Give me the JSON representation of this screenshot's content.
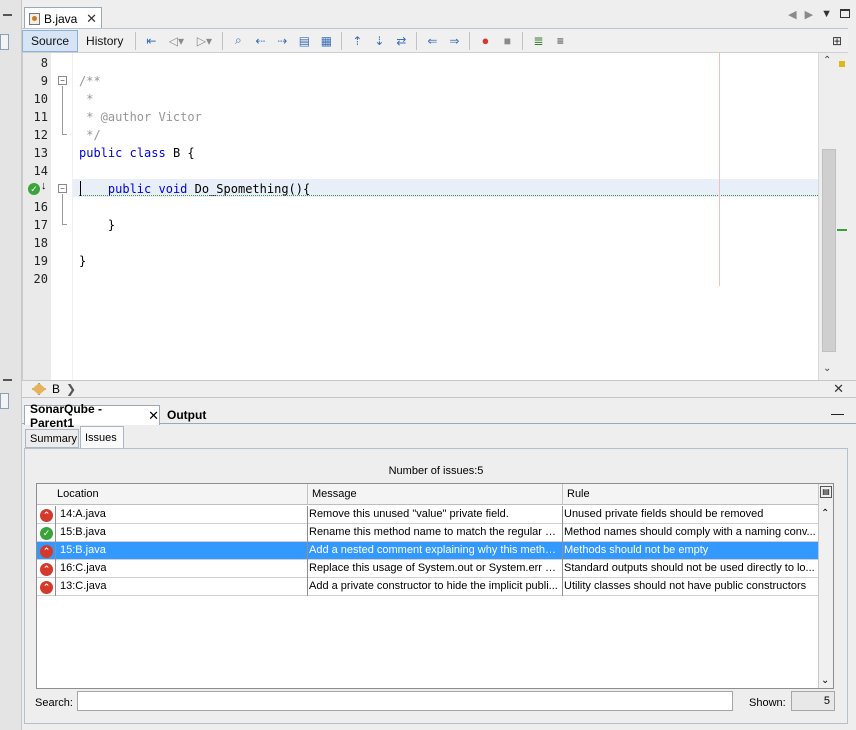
{
  "editor": {
    "file_tab": "B.java",
    "file_tab_close": "✕",
    "view_tabs": [
      "Source",
      "History"
    ],
    "active_view": "Source"
  },
  "code": {
    "line_numbers": [
      "8",
      "9",
      "10",
      "11",
      "12",
      "13",
      "14",
      "",
      "16",
      "17",
      "18",
      "19",
      "20"
    ],
    "lines": [
      {
        "n": "8",
        "text": ""
      },
      {
        "n": "9",
        "text": "/**",
        "cls": "cm"
      },
      {
        "n": "10",
        "text": " *",
        "cls": "cm"
      },
      {
        "n": "11",
        "text": " * @author Victor",
        "cls": "cm"
      },
      {
        "n": "12",
        "text": " */",
        "cls": "cm"
      },
      {
        "n": "13",
        "text": "public class B {"
      },
      {
        "n": "14",
        "text": ""
      },
      {
        "n": "15",
        "text": "    public void Do_Spomething(){"
      },
      {
        "n": "16",
        "text": ""
      },
      {
        "n": "17",
        "text": "    }"
      },
      {
        "n": "18",
        "text": ""
      },
      {
        "n": "19",
        "text": "}"
      },
      {
        "n": "20",
        "text": ""
      }
    ]
  },
  "breadcrumb": {
    "item": "B",
    "close": "✕"
  },
  "bottom": {
    "tabs": [
      {
        "label": "SonarQube - Parent1",
        "close": "✕"
      },
      {
        "label": "Output"
      }
    ],
    "subtabs": [
      "Summary",
      "Issues"
    ],
    "active_subtab": "Issues",
    "issue_count_label": "Number of issues:5",
    "columns": [
      "Location",
      "Message",
      "Rule"
    ],
    "rows": [
      {
        "severity": "bad",
        "location": "14:A.java",
        "message": "Remove this unused \"value\" private field.",
        "rule": "Unused private fields should be removed"
      },
      {
        "severity": "ok",
        "location": "15:B.java",
        "message": "Rename this method name to match the regular e...",
        "rule": "Method names should comply with a naming conv..."
      },
      {
        "severity": "bad",
        "location": "15:B.java",
        "message": "Add a nested comment explaining why this metho...",
        "rule": "Methods should not be empty",
        "selected": true
      },
      {
        "severity": "bad",
        "location": "16:C.java",
        "message": "Replace this usage of System.out or System.err b...",
        "rule": "Standard outputs should not be used directly to lo..."
      },
      {
        "severity": "bad",
        "location": "13:C.java",
        "message": "Add a private constructor to hide the implicit publi...",
        "rule": "Utility classes should not have public constructors"
      }
    ],
    "search_label": "Search:",
    "search_value": "",
    "shown_label": "Shown:",
    "shown_value": "5"
  },
  "colors": {
    "selection": "#3399ff",
    "keyword": "#0000e6",
    "comment": "#969696",
    "error": "#d33a2b",
    "ok": "#3aa33a"
  }
}
